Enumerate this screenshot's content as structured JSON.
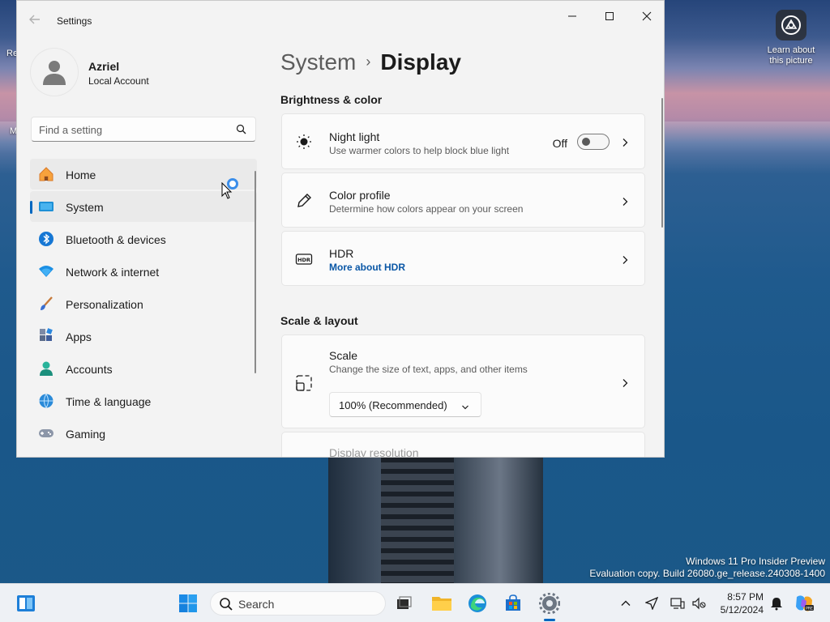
{
  "window": {
    "title": "Settings"
  },
  "user": {
    "name": "Azriel",
    "account_type": "Local Account"
  },
  "search": {
    "placeholder": "Find a setting"
  },
  "nav": {
    "items": [
      {
        "label": "Home",
        "icon": "home-icon"
      },
      {
        "label": "System",
        "icon": "system-icon"
      },
      {
        "label": "Bluetooth & devices",
        "icon": "bluetooth-icon"
      },
      {
        "label": "Network & internet",
        "icon": "network-icon"
      },
      {
        "label": "Personalization",
        "icon": "personalization-icon"
      },
      {
        "label": "Apps",
        "icon": "apps-icon"
      },
      {
        "label": "Accounts",
        "icon": "accounts-icon"
      },
      {
        "label": "Time & language",
        "icon": "time-language-icon"
      },
      {
        "label": "Gaming",
        "icon": "gaming-icon"
      }
    ],
    "selected": "System"
  },
  "breadcrumb": {
    "parent": "System",
    "separator": "›",
    "current": "Display"
  },
  "sections": {
    "brightness": {
      "title": "Brightness & color",
      "night_light": {
        "title": "Night light",
        "subtitle": "Use warmer colors to help block blue light",
        "state_label": "Off"
      },
      "color_profile": {
        "title": "Color profile",
        "subtitle": "Determine how colors appear on your screen"
      },
      "hdr": {
        "title": "HDR",
        "link": "More about HDR"
      }
    },
    "scale_layout": {
      "title": "Scale & layout",
      "scale": {
        "title": "Scale",
        "subtitle": "Change the size of text, apps, and other items",
        "value": "100% (Recommended)"
      },
      "display_resolution": {
        "title": "Display resolution"
      }
    }
  },
  "desktop": {
    "spotlight_label": "Learn about this picture",
    "watermark_line1": "Windows 11 Pro Insider Preview",
    "watermark_line2": "Evaluation copy. Build 26080.ge_release.240308-1400",
    "edge_labels": [
      "Re",
      "M"
    ]
  },
  "taskbar": {
    "search_label": "Search",
    "time": "8:57 PM",
    "date": "5/12/2024"
  },
  "colors": {
    "accent": "#0067c0",
    "link": "#0a57a6"
  }
}
